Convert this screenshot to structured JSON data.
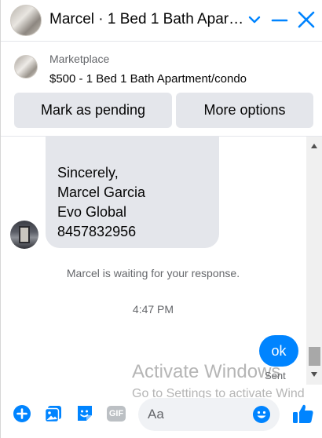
{
  "header": {
    "title": "Marcel · 1 Bed 1 Bath Apart…",
    "avatar_icon": "avatar",
    "chevron_icon": "chevron-down-icon",
    "minimize_icon": "minimize-icon",
    "close_icon": "close-icon"
  },
  "marketplace": {
    "source": "Marketplace",
    "listing": "$500 - 1 Bed 1 Bath Apartment/condo",
    "mark_pending_label": "Mark as pending",
    "more_options_label": "More options"
  },
  "messages": {
    "incoming_lines": [
      "",
      "Sincerely,",
      "Marcel Garcia",
      "Evo Global",
      "8457832956"
    ],
    "waiting_text": "Marcel is waiting for your response.",
    "timestamp": "4:47 PM",
    "outgoing_text": "ok",
    "status": "Sent"
  },
  "watermark": {
    "line1": "Activate Windows",
    "line2": "Go to Settings to activate Wind"
  },
  "composer": {
    "placeholder": "Aa",
    "gif_label": "GIF"
  },
  "colors": {
    "accent": "#0084ff",
    "bubble_in": "#e4e6eb",
    "button_bg": "#e4e6eb",
    "muted_text": "#65676b"
  }
}
